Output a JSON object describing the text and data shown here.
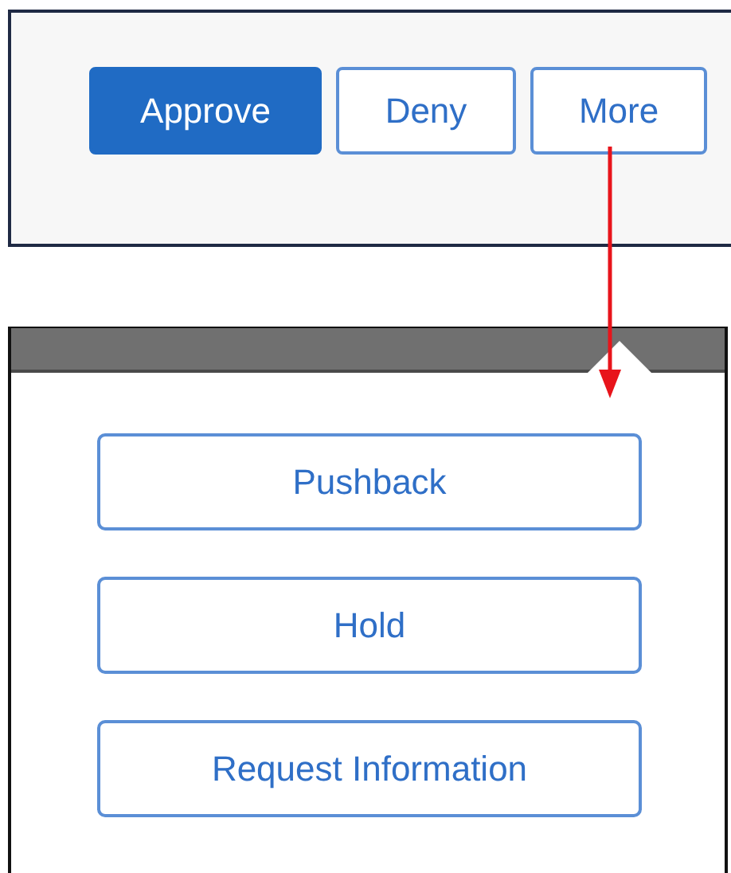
{
  "action_bar": {
    "buttons": [
      {
        "label": "Approve",
        "kind": "primary"
      },
      {
        "label": "Deny",
        "kind": "secondary"
      },
      {
        "label": "More",
        "kind": "secondary"
      }
    ]
  },
  "more_menu": {
    "items": [
      {
        "label": "Pushback"
      },
      {
        "label": "Hold"
      },
      {
        "label": "Request Information"
      }
    ]
  }
}
